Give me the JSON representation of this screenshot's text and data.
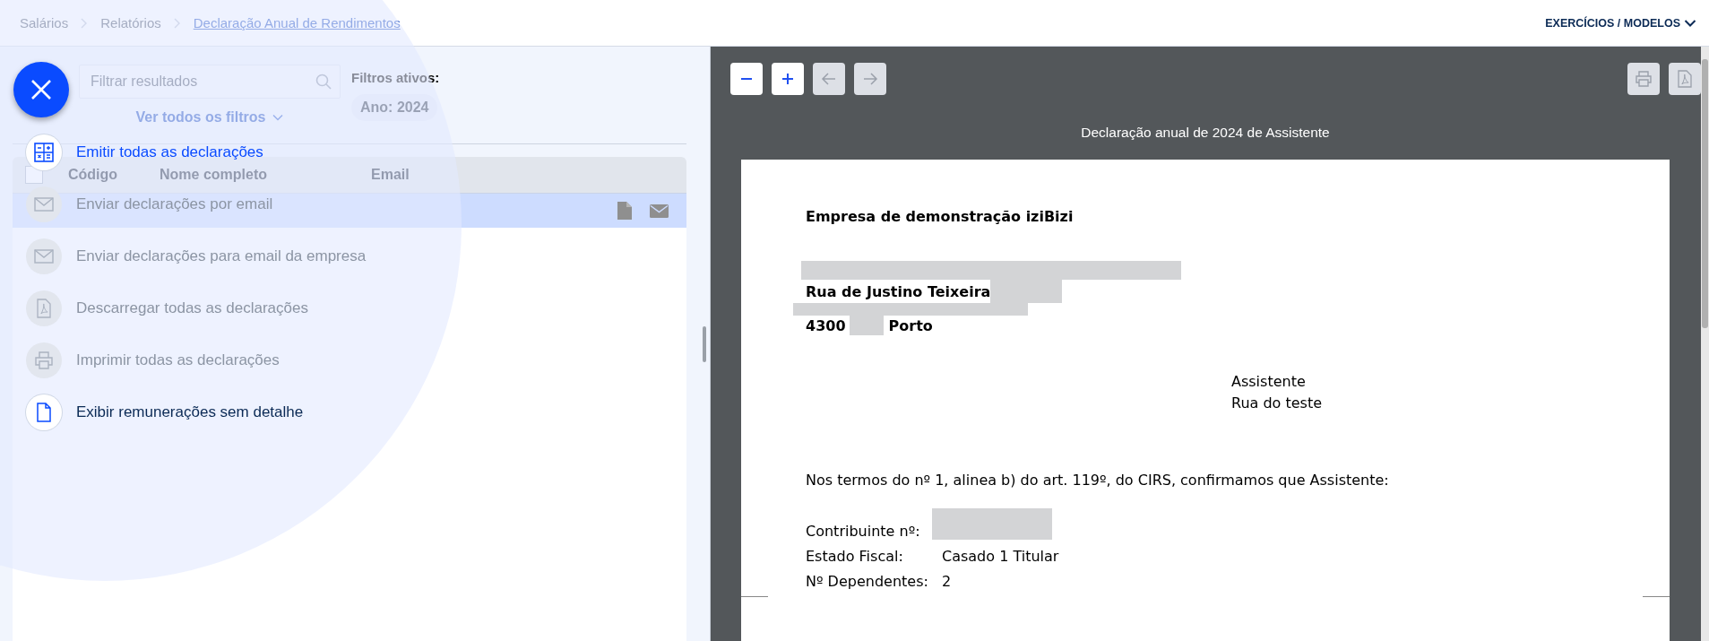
{
  "breadcrumb": [
    {
      "label": "Salários",
      "current": false
    },
    {
      "label": "Relatórios",
      "current": false
    },
    {
      "label": "Declaração Anual de Rendimentos",
      "current": true
    }
  ],
  "top_menu": {
    "label": "EXERCÍCIOS / MODELOS"
  },
  "search": {
    "placeholder": "Filtrar resultados"
  },
  "filters": {
    "title": "Filtros ativos:",
    "chips": [
      "Ano: 2024"
    ],
    "toggle": "Ver todos os filtros"
  },
  "table": {
    "select_all": {
      "checked": false
    },
    "columns": [
      "Código",
      "Nome completo",
      "Email"
    ],
    "rows": [
      {
        "selected": true
      }
    ]
  },
  "action_menu": {
    "items": [
      {
        "label": "Emitir todas as declarações",
        "disabled": false,
        "selected": true
      },
      {
        "label": "Enviar declarações por email",
        "disabled": true,
        "selected": false
      },
      {
        "label": "Enviar declarações para email da empresa",
        "disabled": true,
        "selected": false
      },
      {
        "label": "Descarregar todas as declarações",
        "disabled": true,
        "selected": false
      },
      {
        "label": "Imprimir todas as declarações",
        "disabled": true,
        "selected": false
      },
      {
        "label": "Exibir remunerações sem detalhe",
        "disabled": false,
        "selected": false
      }
    ]
  },
  "viewer": {
    "toolbar_left": [
      {
        "disabled": false
      },
      {
        "disabled": false
      },
      {
        "disabled": true
      },
      {
        "disabled": true
      }
    ],
    "toolbar_right": [
      {
        "disabled": true
      },
      {
        "disabled": true
      }
    ],
    "title": "Declaração anual de 2024 de Assistente",
    "document": {
      "company": "Empresa de demonstração iziBizi",
      "street": "Rua de Justino Teixeira",
      "postal_code": "4300",
      "city": "Porto",
      "recipient": [
        "Assistente",
        "Rua do teste"
      ],
      "intro": "Nos termos do nº 1, alinea b) do art. 119º, do CIRS, confirmamos que Assistente:",
      "fields": [
        {
          "label": "Contribuinte nº:",
          "redacted": true
        },
        {
          "label": "Estado Fiscal:",
          "redacted": false,
          "value": "Casado 1 Titular"
        },
        {
          "label": "Nº Dependentes:",
          "redacted": false,
          "value": "2"
        }
      ]
    }
  }
}
